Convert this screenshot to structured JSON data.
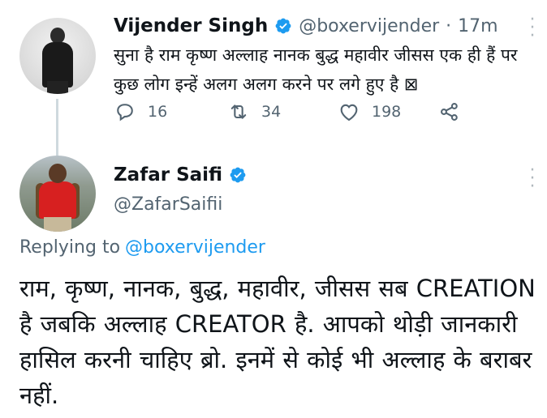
{
  "tweet": {
    "author_name": "Vijender Singh",
    "handle": "@boxervijender",
    "separator": "·",
    "time": "17m",
    "text": "सुना है राम कृष्ण अल्लाह नानक बुद्ध महावीर जीसस एक ही हैं पर कुछ लोग इन्हें अलग अलग करने पर लगे हुए है ⊠",
    "reply_count": "16",
    "retweet_count": "34",
    "like_count": "198"
  },
  "reply": {
    "author_name": "Zafar Saifi",
    "handle": "@ZafarSaifii",
    "replying_prefix": "Replying to",
    "replying_to": "@boxervijender",
    "text": "राम, कृष्ण, नानक, बुद्ध, महावीर, जीसस सब CREATION है जबकि अल्लाह CREATOR है. आपको थोड़ी जानकारी हासिल करनी चाहिए ब्रो. इनमें से कोई भी अल्लाह के बराबर नहीं."
  },
  "icons": {
    "verified": "verified-badge-icon",
    "more": "more-options-icon",
    "reply": "reply-icon",
    "retweet": "retweet-icon",
    "like": "heart-icon",
    "share": "share-icon"
  },
  "colors": {
    "verified_blue": "#1d9bf0",
    "secondary_text": "#536471",
    "primary_text": "#0f1419",
    "link_blue": "#1d9bf0"
  }
}
